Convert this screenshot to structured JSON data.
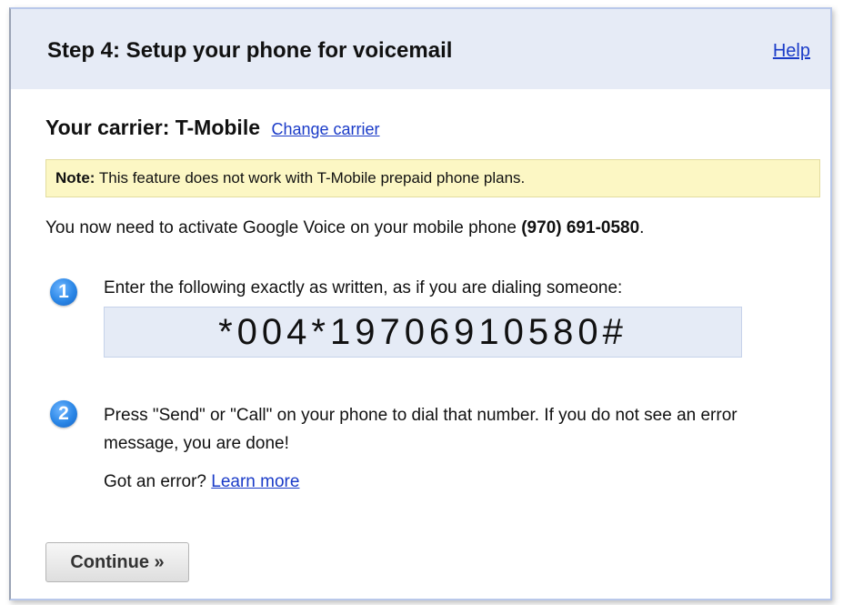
{
  "header": {
    "title": "Step 4: Setup your phone for voicemail",
    "help_label": "Help"
  },
  "carrier": {
    "label": "Your carrier: T-Mobile",
    "change_label": "Change carrier"
  },
  "note": {
    "prefix": "Note:",
    "text": " This feature does not work with T-Mobile prepaid phone plans."
  },
  "activate": {
    "text": "You now need to activate Google Voice on your mobile phone ",
    "phone": "(970) 691-0580",
    "suffix": "."
  },
  "steps": [
    {
      "number": "1",
      "text": "Enter the following exactly as written, as if you are dialing someone:",
      "code": "*004*19706910580#"
    },
    {
      "number": "2",
      "text": "Press \"Send\" or \"Call\" on your phone to dial that number. If you do not see an error message, you are done!"
    }
  ],
  "error": {
    "text": "Got an error? ",
    "link_label": "Learn more"
  },
  "continue_label": "Continue »",
  "colors": {
    "header_bg": "#e6ebf6",
    "link": "#1a3bc8",
    "note_bg": "#fcf7c4",
    "code_bg": "#e5ebf6",
    "step_icon": "#2a86e6"
  }
}
